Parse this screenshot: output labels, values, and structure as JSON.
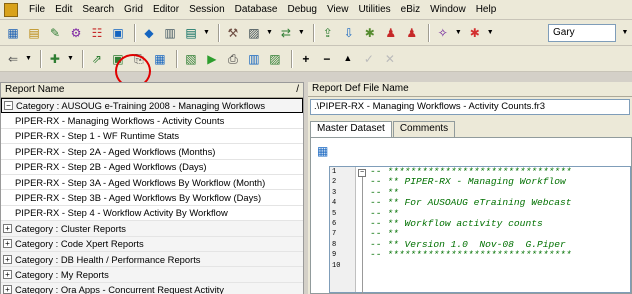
{
  "menubar": {
    "items": [
      "File",
      "Edit",
      "Search",
      "Grid",
      "Editor",
      "Session",
      "Database",
      "Debug",
      "View",
      "Utilities",
      "eBiz",
      "Window",
      "Help"
    ]
  },
  "toolbar": {
    "user_value": "Gary"
  },
  "left_panel": {
    "column_header": "Report Name",
    "rows": [
      {
        "kind": "category",
        "expander": "−",
        "label": "Category : AUSOUG e-Training 2008 - Managing Workflows"
      },
      {
        "kind": "report",
        "label": "PIPER-RX - Managing Workflows - Activity Counts"
      },
      {
        "kind": "report",
        "label": "PIPER-RX - Step 1 - WF Runtime Stats"
      },
      {
        "kind": "report",
        "label": "PIPER-RX - Step 2A - Aged Workflows (Months)"
      },
      {
        "kind": "report",
        "label": "PIPER-RX - Step 2B - Aged Workflows (Days)"
      },
      {
        "kind": "report",
        "label": "PIPER-RX - Step 3A - Aged Workflows By Workflow (Month)"
      },
      {
        "kind": "report",
        "label": "PIPER-RX - Step 3B - Aged Workflows By Workflow (Days)"
      },
      {
        "kind": "report",
        "label": "PIPER-RX - Step 4 - Workflow Activity By Workflow"
      },
      {
        "kind": "category",
        "expander": "+",
        "label": "Category : Cluster Reports"
      },
      {
        "kind": "category",
        "expander": "+",
        "label": "Category : Code Xpert Reports"
      },
      {
        "kind": "category",
        "expander": "+",
        "label": "Category : DB Health / Performance Reports"
      },
      {
        "kind": "category",
        "expander": "+",
        "label": "Category : My Reports"
      },
      {
        "kind": "category",
        "expander": "+",
        "label": "Category : Ora Apps - Concurrent Request Activity"
      }
    ]
  },
  "right_panel": {
    "def_label": "Report Def File Name",
    "def_value": ".\\PIPER-RX - Managing Workflows - Activity Counts.fr3",
    "tabs": [
      "Master Dataset",
      "Comments"
    ],
    "line_numbers": [
      "1",
      "2",
      "3",
      "4",
      "5",
      "6",
      "7",
      "8",
      "9",
      "10"
    ],
    "code_lines": [
      "-- ********************************",
      "-- ** PIPER-RX - Managing Workflow",
      "-- **",
      "-- ** For AUSOAUG eTraining Webcast",
      "-- **",
      "-- ** Workflow activity counts",
      "-- **",
      "-- ** Version 1.0  Nov-08  G.Piper",
      "-- ********************************",
      ""
    ]
  }
}
